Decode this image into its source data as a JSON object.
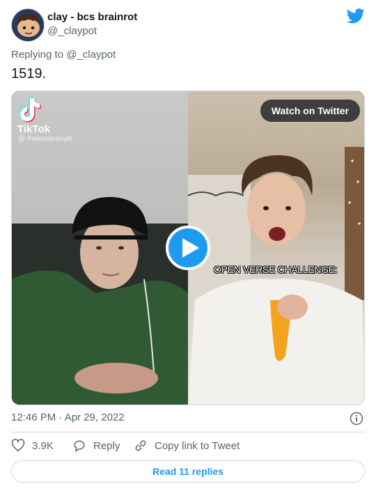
{
  "author": {
    "display_name": "clay - bcs brainrot",
    "handle": "@_claypot"
  },
  "reply_context": {
    "prefix": "Replying to ",
    "mention": "@_claypot"
  },
  "tweet": {
    "text": "1519."
  },
  "media": {
    "tiktok_brand": "TikTok",
    "tiktok_user": "@ thekonandoyle",
    "watch_label": "Watch on Twitter",
    "overlay_caption": "OPEN VERSE CHALLENGE:"
  },
  "meta": {
    "timestamp": "12:46 PM · Apr 29, 2022"
  },
  "actions": {
    "likes": "3.9K",
    "reply_label": "Reply",
    "copy_label": "Copy link to Tweet"
  },
  "footer": {
    "read_replies": "Read 11 replies"
  },
  "colors": {
    "twitter_blue": "#1d9bf0",
    "secondary_text": "#536471",
    "border": "#cfd9de"
  }
}
